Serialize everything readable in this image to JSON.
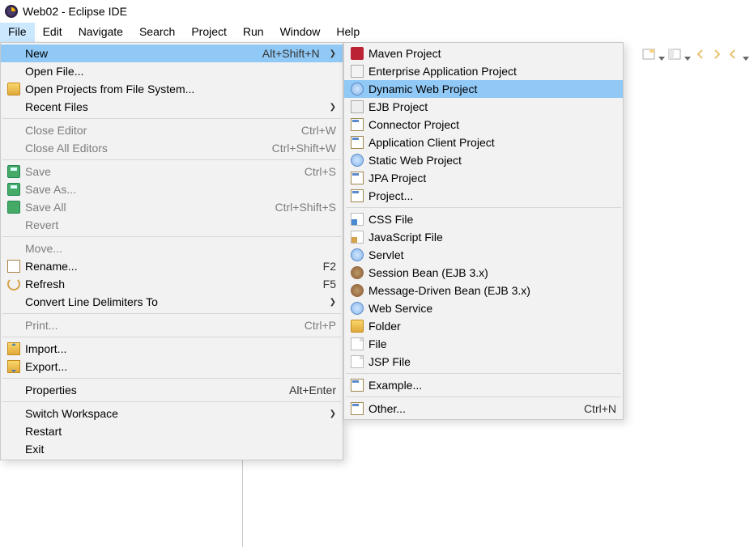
{
  "window": {
    "title": "Web02 - Eclipse IDE"
  },
  "menubar": {
    "items": [
      "File",
      "Edit",
      "Navigate",
      "Search",
      "Project",
      "Run",
      "Window",
      "Help"
    ],
    "active_index": 0
  },
  "file_menu": {
    "items": [
      {
        "type": "item",
        "label": "New",
        "accel": "Alt+Shift+N",
        "submenu": true,
        "highlight": true,
        "icon": ""
      },
      {
        "type": "item",
        "label": "Open File...",
        "icon": ""
      },
      {
        "type": "item",
        "label": "Open Projects from File System...",
        "icon": "folderopen"
      },
      {
        "type": "item",
        "label": "Recent Files",
        "submenu": true,
        "icon": ""
      },
      {
        "type": "sep"
      },
      {
        "type": "item",
        "label": "Close Editor",
        "accel": "Ctrl+W",
        "disabled": true,
        "icon": ""
      },
      {
        "type": "item",
        "label": "Close All Editors",
        "accel": "Ctrl+Shift+W",
        "disabled": true,
        "icon": ""
      },
      {
        "type": "sep"
      },
      {
        "type": "item",
        "label": "Save",
        "accel": "Ctrl+S",
        "disabled": true,
        "icon": "save"
      },
      {
        "type": "item",
        "label": "Save As...",
        "disabled": true,
        "icon": "save"
      },
      {
        "type": "item",
        "label": "Save All",
        "accel": "Ctrl+Shift+S",
        "disabled": true,
        "icon": "saveall"
      },
      {
        "type": "item",
        "label": "Revert",
        "disabled": true,
        "icon": ""
      },
      {
        "type": "sep"
      },
      {
        "type": "item",
        "label": "Move...",
        "disabled": true,
        "icon": ""
      },
      {
        "type": "item",
        "label": "Rename...",
        "accel": "F2",
        "icon": "rename"
      },
      {
        "type": "item",
        "label": "Refresh",
        "accel": "F5",
        "icon": "refresh"
      },
      {
        "type": "item",
        "label": "Convert Line Delimiters To",
        "submenu": true,
        "icon": ""
      },
      {
        "type": "sep"
      },
      {
        "type": "item",
        "label": "Print...",
        "accel": "Ctrl+P",
        "disabled": true,
        "icon": ""
      },
      {
        "type": "sep"
      },
      {
        "type": "item",
        "label": "Import...",
        "icon": "import"
      },
      {
        "type": "item",
        "label": "Export...",
        "icon": "export"
      },
      {
        "type": "sep"
      },
      {
        "type": "item",
        "label": "Properties",
        "accel": "Alt+Enter",
        "icon": ""
      },
      {
        "type": "sep"
      },
      {
        "type": "item",
        "label": "Switch Workspace",
        "submenu": true,
        "icon": ""
      },
      {
        "type": "item",
        "label": "Restart",
        "icon": ""
      },
      {
        "type": "item",
        "label": "Exit",
        "icon": ""
      }
    ]
  },
  "new_menu": {
    "items": [
      {
        "type": "item",
        "label": "Maven Project",
        "icon": "maven"
      },
      {
        "type": "item",
        "label": "Enterprise Application Project",
        "icon": "ear"
      },
      {
        "type": "item",
        "label": "Dynamic Web Project",
        "highlight": true,
        "icon": "globe"
      },
      {
        "type": "item",
        "label": "EJB Project",
        "icon": "ejb"
      },
      {
        "type": "item",
        "label": "Connector Project",
        "icon": "proj"
      },
      {
        "type": "item",
        "label": "Application Client Project",
        "icon": "proj"
      },
      {
        "type": "item",
        "label": "Static Web Project",
        "icon": "globe"
      },
      {
        "type": "item",
        "label": "JPA Project",
        "icon": "proj"
      },
      {
        "type": "item",
        "label": "Project...",
        "icon": "proj"
      },
      {
        "type": "sep"
      },
      {
        "type": "item",
        "label": "CSS File",
        "icon": "css"
      },
      {
        "type": "item",
        "label": "JavaScript File",
        "icon": "js"
      },
      {
        "type": "item",
        "label": "Servlet",
        "icon": "globe"
      },
      {
        "type": "item",
        "label": "Session Bean (EJB 3.x)",
        "icon": "bean"
      },
      {
        "type": "item",
        "label": "Message-Driven Bean (EJB 3.x)",
        "icon": "bean"
      },
      {
        "type": "item",
        "label": "Web Service",
        "icon": "globe"
      },
      {
        "type": "item",
        "label": "Folder",
        "icon": "folder"
      },
      {
        "type": "item",
        "label": "File",
        "icon": "file"
      },
      {
        "type": "item",
        "label": "JSP File",
        "icon": "file"
      },
      {
        "type": "sep"
      },
      {
        "type": "item",
        "label": "Example...",
        "icon": "proj"
      },
      {
        "type": "sep"
      },
      {
        "type": "item",
        "label": "Other...",
        "accel": "Ctrl+N",
        "icon": "proj"
      }
    ]
  }
}
